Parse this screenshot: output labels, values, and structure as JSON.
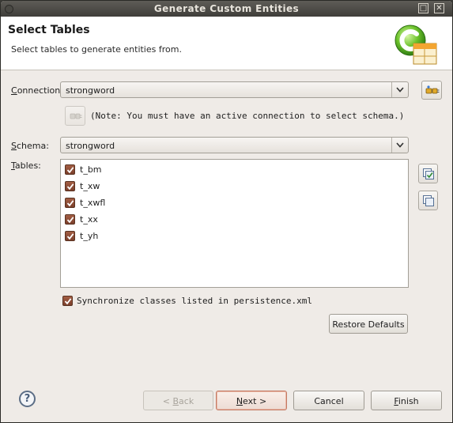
{
  "window": {
    "title": "Generate Custom Entities",
    "min_glyph": "□",
    "close_glyph": "✕"
  },
  "header": {
    "title": "Select Tables",
    "description": "Select tables to generate entities from."
  },
  "connection": {
    "label_u": "C",
    "label_rest": "onnection:",
    "value": "strongword",
    "note": "(Note: You must have an active connection to select schema.)"
  },
  "schema": {
    "label_u": "S",
    "label_rest": "chema:",
    "value": "strongword"
  },
  "tables": {
    "label_u": "T",
    "label_rest": "ables:",
    "items": [
      {
        "name": "t_bm",
        "checked": true
      },
      {
        "name": "t_xw",
        "checked": true
      },
      {
        "name": "t_xwfl",
        "checked": true
      },
      {
        "name": "t_xx",
        "checked": true
      },
      {
        "name": "t_yh",
        "checked": true
      }
    ]
  },
  "sync": {
    "label": "Synchronize classes listed in persistence.xml",
    "checked": true
  },
  "restore_defaults": "Restore Defaults",
  "footer": {
    "help_glyph": "?",
    "back": {
      "arrow": "<",
      "u": "B",
      "rest": "ack"
    },
    "next": {
      "u": "N",
      "rest": "ext",
      "arrow": ">"
    },
    "cancel": "Cancel",
    "finish": {
      "u": "F",
      "rest": "inish"
    }
  },
  "colors": {
    "accent_checkbox": "#8a4a33",
    "titlebar": "#4b4a46",
    "focus_border": "#c47a63"
  }
}
